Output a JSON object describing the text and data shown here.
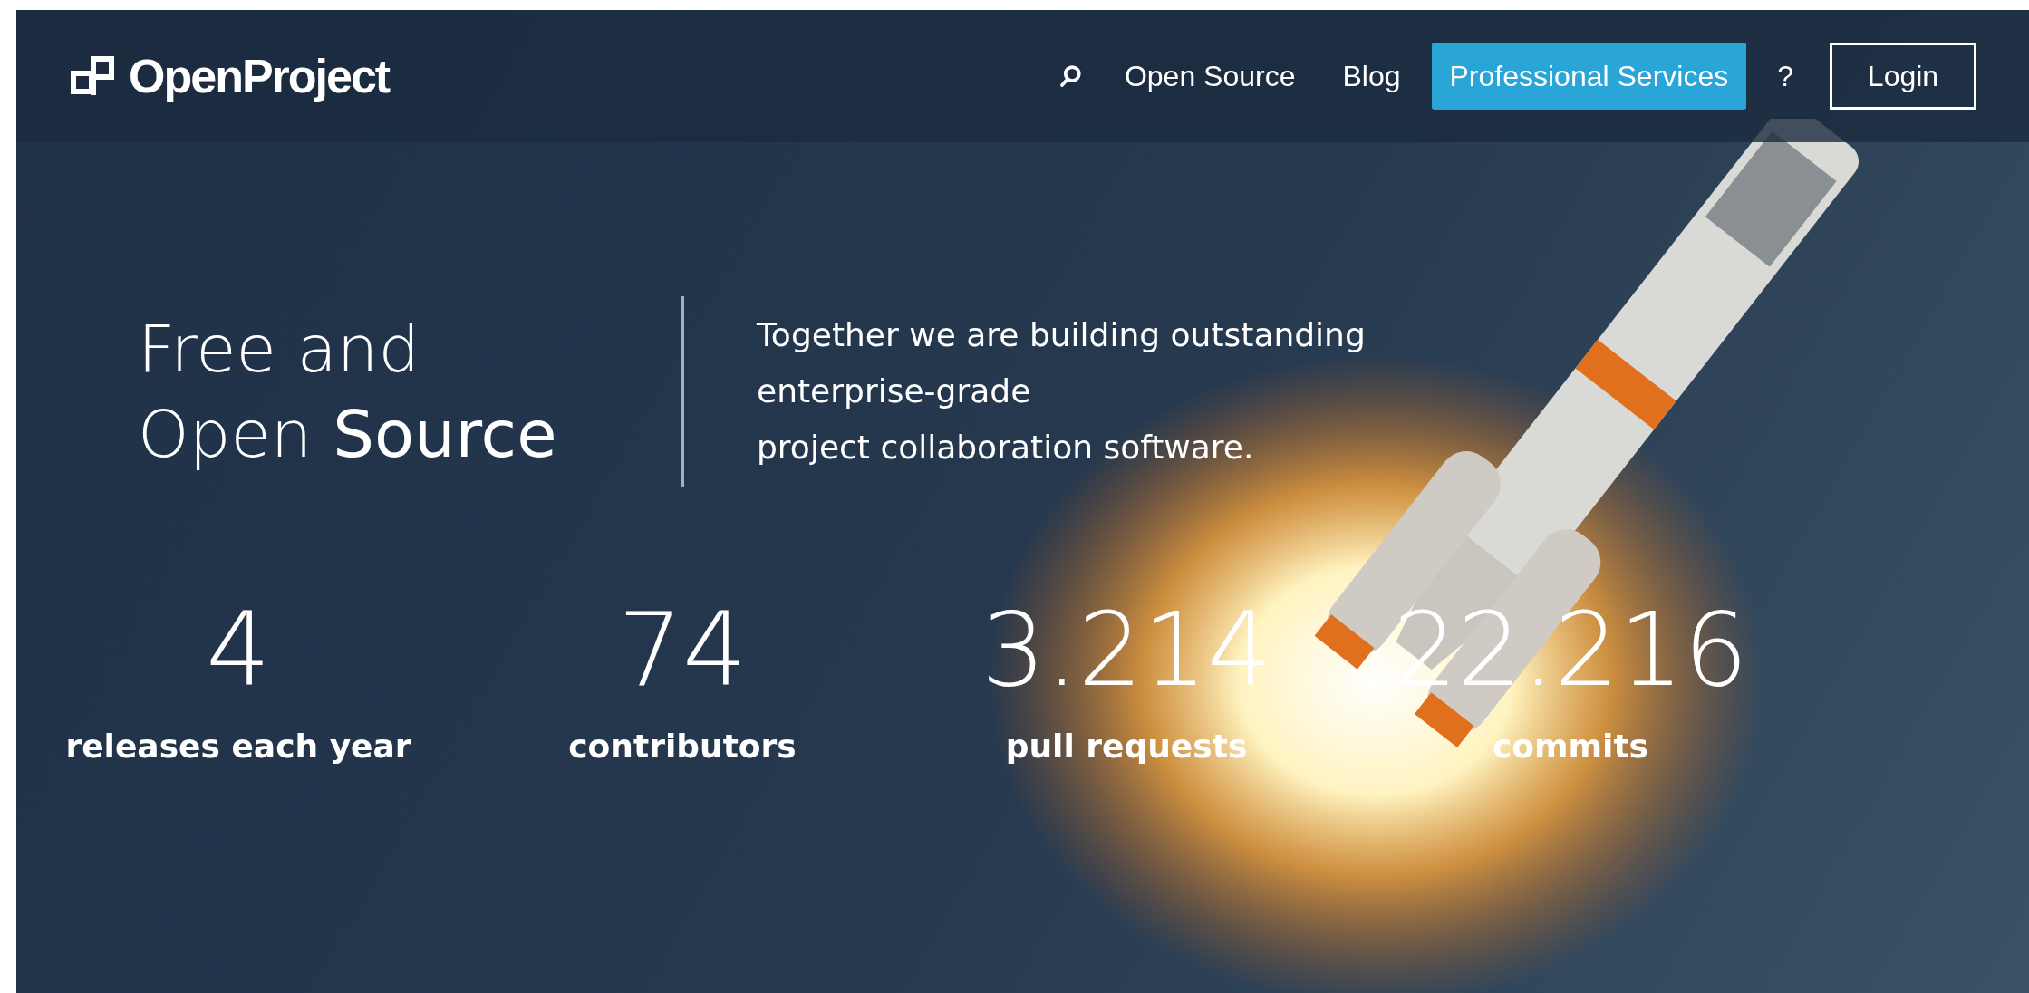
{
  "header": {
    "logo": "OpenProject",
    "nav": [
      {
        "kind": "search"
      },
      {
        "kind": "link",
        "label": "Open Source"
      },
      {
        "kind": "link",
        "label": "Blog"
      },
      {
        "kind": "primary",
        "label": "Professional Services"
      },
      {
        "kind": "link",
        "label": "?"
      },
      {
        "kind": "outline",
        "label": "Login"
      }
    ]
  },
  "hero": {
    "heading": "Free and Open **Source**",
    "tagline_lines": [
      "Together we are building outstanding",
      "enterprise-grade",
      "project collaboration software."
    ]
  },
  "stats": [
    {
      "value": "4",
      "label": "releases each year"
    },
    {
      "value": "74",
      "label": "contributors"
    },
    {
      "value": "3.214",
      "label": "pull requests"
    },
    {
      "value": "22.216",
      "label": "commits"
    }
  ]
}
